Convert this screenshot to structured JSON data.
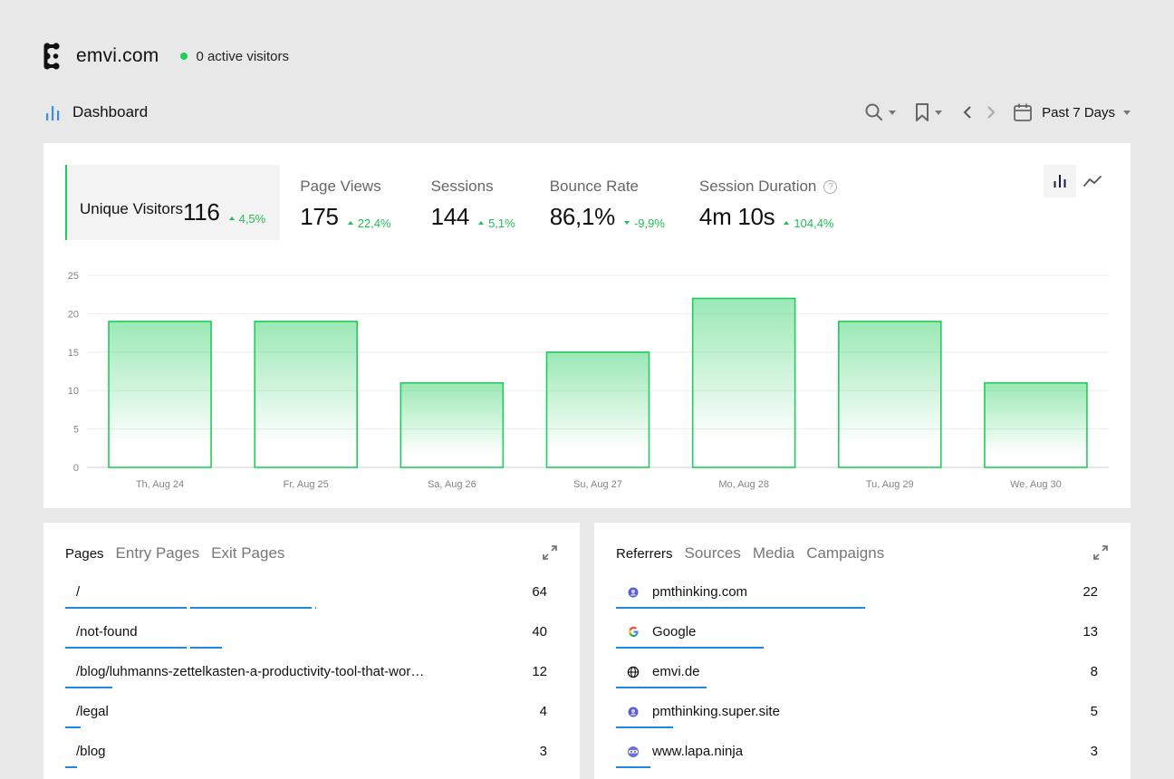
{
  "header": {
    "site_name": "emvi.com",
    "active_visitors": "0 active visitors",
    "status_color": "#1fcd5a"
  },
  "subheader": {
    "title": "Dashboard",
    "date_range": "Past 7 Days"
  },
  "metrics": [
    {
      "label": "Unique Visitors",
      "value": "116",
      "delta": "4,5%",
      "direction": "up",
      "active": true
    },
    {
      "label": "Page Views",
      "value": "175",
      "delta": "22,4%",
      "direction": "up",
      "active": false
    },
    {
      "label": "Sessions",
      "value": "144",
      "delta": "5,1%",
      "direction": "up",
      "active": false
    },
    {
      "label": "Bounce Rate",
      "value": "86,1%",
      "delta": "-9,9%",
      "direction": "down",
      "active": false
    },
    {
      "label": "Session Duration",
      "value": "4m 10s",
      "delta": "104,4%",
      "direction": "up",
      "active": false,
      "help": "?"
    }
  ],
  "chart_data": {
    "type": "bar",
    "title": "Unique Visitors",
    "categories": [
      "Th, Aug 24",
      "Fr, Aug 25",
      "Sa, Aug 26",
      "Su, Aug 27",
      "Mo, Aug 28",
      "Tu, Aug 29",
      "We, Aug 30"
    ],
    "values": [
      19,
      19,
      11,
      15,
      22,
      19,
      11
    ],
    "yticks": [
      0,
      5,
      10,
      15,
      20,
      25
    ],
    "ylim": [
      0,
      25
    ],
    "xlabel": "",
    "ylabel": "",
    "grid": true,
    "bar_color": "#1fcd5a"
  },
  "pages_panel": {
    "tabs": [
      "Pages",
      "Entry Pages",
      "Exit Pages"
    ],
    "active_tab": 0,
    "max": 64,
    "rows": [
      {
        "name": "/",
        "count": 64
      },
      {
        "name": "/not-found",
        "count": 40
      },
      {
        "name": "/blog/luhmanns-zettelkasten-a-productivity-tool-that-wor…",
        "count": 12
      },
      {
        "name": "/legal",
        "count": 4
      },
      {
        "name": "/blog",
        "count": 3
      }
    ]
  },
  "referrers_panel": {
    "tabs": [
      "Referrers",
      "Sources",
      "Media",
      "Campaigns"
    ],
    "active_tab": 0,
    "max": 22,
    "rows": [
      {
        "name": "pmthinking.com",
        "count": 22,
        "icon": "pmthinking-favicon"
      },
      {
        "name": "Google",
        "count": 13,
        "icon": "google-icon"
      },
      {
        "name": "emvi.de",
        "count": 8,
        "icon": "globe-icon"
      },
      {
        "name": "pmthinking.super.site",
        "count": 5,
        "icon": "pmthinking-favicon"
      },
      {
        "name": "www.lapa.ninja",
        "count": 3,
        "icon": "lapa-ninja-favicon"
      }
    ]
  },
  "colors": {
    "accent_green": "#1fcd5a",
    "bar_blue": "#1e88e5",
    "background": "#e8e8e8"
  }
}
